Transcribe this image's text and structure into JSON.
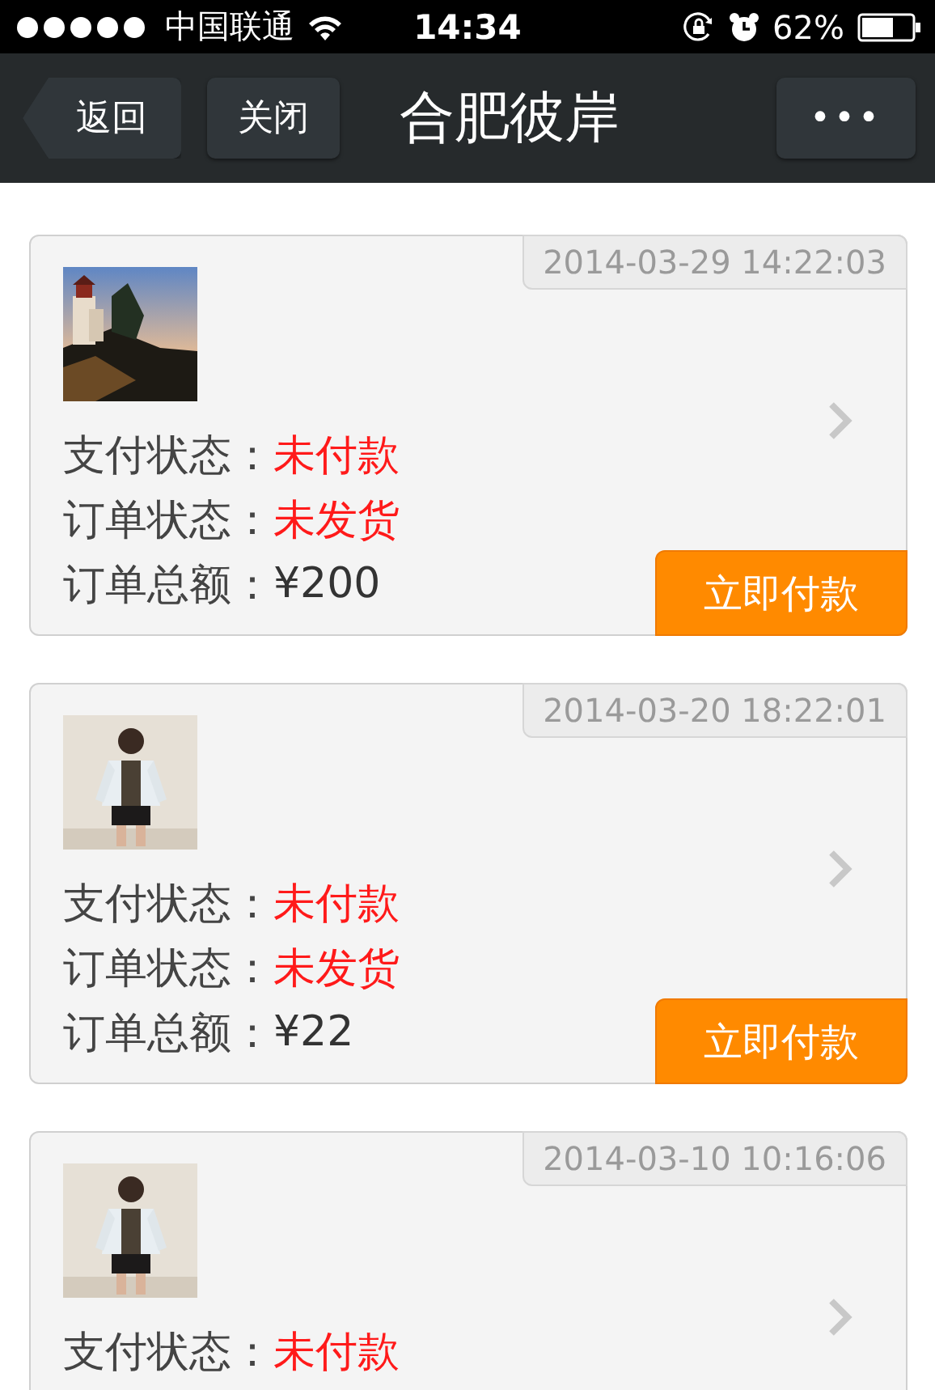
{
  "status_bar": {
    "carrier": "中国联通",
    "time": "14:34",
    "battery": "62%"
  },
  "navbar": {
    "back": "返回",
    "close": "关闭",
    "title": "合肥彼岸",
    "more": "•••"
  },
  "orders": [
    {
      "time": "2014-03-29 14:22:03",
      "picture": {
        "kind": "landscape"
      },
      "rows": [
        {
          "label": "支付状态：",
          "value": "未付款",
          "kind": "status"
        },
        {
          "label": "订单状态：",
          "value": "未发货",
          "kind": "status"
        },
        {
          "label": "订单总额：",
          "value": "¥200",
          "kind": "amount"
        }
      ],
      "pay_button": "立即付款"
    },
    {
      "time": "2014-03-20 18:22:01",
      "picture": {
        "kind": "figure"
      },
      "rows": [
        {
          "label": "支付状态：",
          "value": "未付款",
          "kind": "status"
        },
        {
          "label": "订单状态：",
          "value": "未发货",
          "kind": "status"
        },
        {
          "label": "订单总额：",
          "value": "¥22",
          "kind": "amount"
        }
      ],
      "pay_button": "立即付款"
    },
    {
      "time": "2014-03-10 10:16:06",
      "picture": {
        "kind": "figure"
      },
      "rows": [
        {
          "label": "支付状态：",
          "value": "未付款",
          "kind": "status"
        }
      ]
    }
  ]
}
